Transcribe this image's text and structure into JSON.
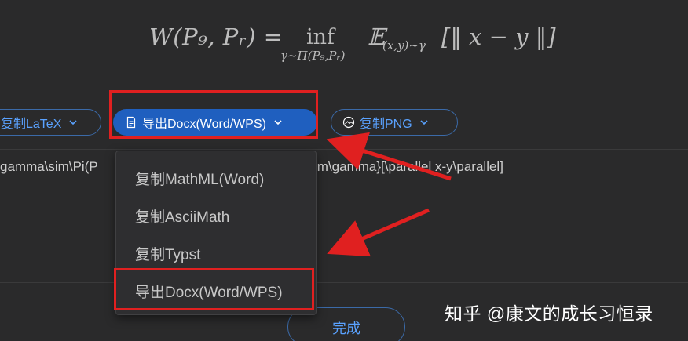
{
  "formula": {
    "main": "W(P₉, Pᵣ) =",
    "inf": "inf",
    "inf_sub": "γ∼Π(P₉,Pᵣ)",
    "expect": "𝔼",
    "expect_sub": "(x,y)∼γ",
    "rest": "[‖ x − y ‖]"
  },
  "toolbar": {
    "copy_latex_label": "复制LaTeX",
    "export_docx_label": "导出Docx(Word/WPS)",
    "copy_png_label": "复制PNG"
  },
  "latex_text": {
    "left": "gamma\\sim\\Pi(P",
    "right": "im\\gamma}[\\parallel x-y\\parallel]"
  },
  "dropdown": {
    "items": [
      "复制MathML(Word)",
      "复制AsciiMath",
      "复制Typst",
      "导出Docx(Word/WPS)"
    ]
  },
  "done_label": "完成",
  "watermark": "知乎 @康文的成长习恒录",
  "colors": {
    "background": "#2a2a2b",
    "accent": "#1f5fbf",
    "link": "#5aa2ff",
    "highlight": "#e02020"
  }
}
